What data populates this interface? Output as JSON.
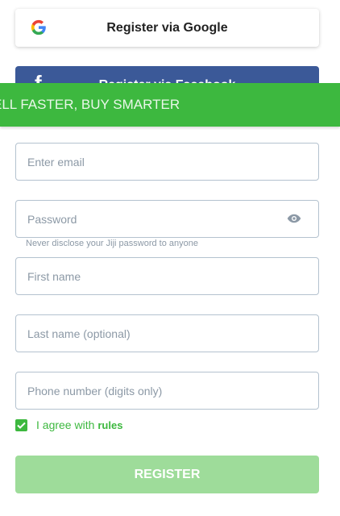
{
  "social": {
    "google_label": "Register via Google",
    "facebook_label": "Register via Facebook"
  },
  "banner": {
    "text": "ELL FASTER, BUY SMARTER"
  },
  "form": {
    "email_placeholder": "Enter email",
    "password_placeholder": "Password",
    "password_hint": "Never disclose your Jiji password to anyone",
    "first_name_placeholder": "First name",
    "last_name_placeholder": "Last name (optional)",
    "phone_placeholder": "Phone number (digits only)",
    "agree_text": "I agree with",
    "rules_link": "rules",
    "agree_checked": true,
    "register_label": "REGISTER"
  },
  "icons": {
    "google": "google-g-icon",
    "facebook": "facebook-f-icon",
    "eye": "eye-icon",
    "check": "check-icon"
  },
  "colors": {
    "accent": "#3db83f",
    "register_disabled": "#9edc9a",
    "facebook": "#3b5998",
    "field_border": "#b4c2cf",
    "placeholder": "#8c99a6"
  }
}
